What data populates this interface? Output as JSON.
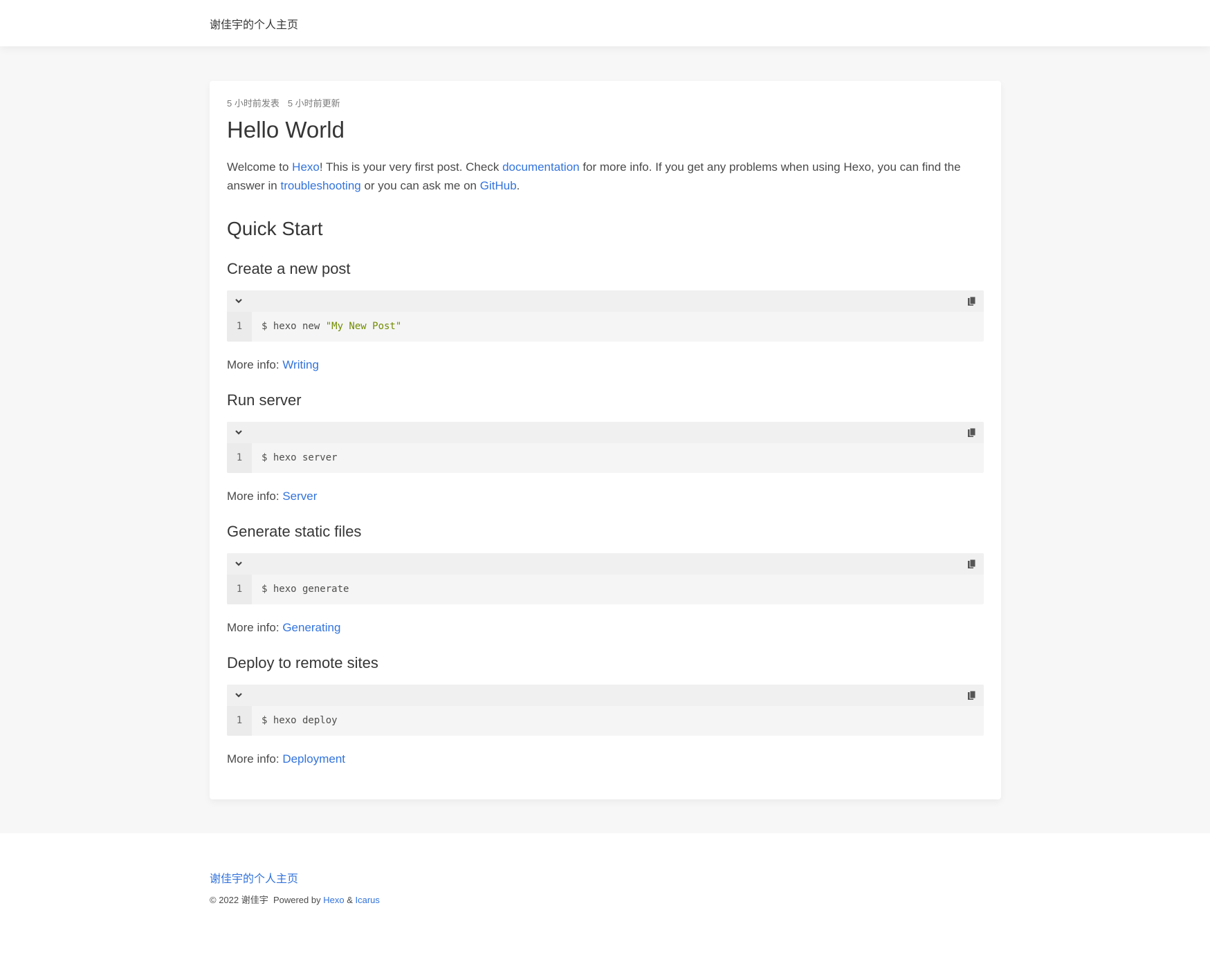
{
  "navbar": {
    "brand": "谢佳宇的个人主页"
  },
  "post": {
    "published": "5 小时前发表",
    "updated": "5 小时前更新",
    "title": "Hello World",
    "intro": {
      "t1": "Welcome to ",
      "link_hexo": "Hexo",
      "t2": "! This is your very first post. Check ",
      "link_docs": "documentation",
      "t3": " for more info. If you get any problems when using Hexo, you can find the answer in ",
      "link_trouble": "troubleshooting",
      "t4": " or you can ask me on ",
      "link_github": "GitHub",
      "t5": "."
    },
    "quick_start": "Quick Start",
    "more_info_label": "More info: ",
    "sections": [
      {
        "heading": "Create a new post",
        "line_no": "1",
        "code_prefix": "$ hexo new ",
        "code_string": "\"My New Post\"",
        "link": "Writing"
      },
      {
        "heading": "Run server",
        "line_no": "1",
        "code_prefix": "$ hexo server",
        "code_string": "",
        "link": "Server"
      },
      {
        "heading": "Generate static files",
        "line_no": "1",
        "code_prefix": "$ hexo generate",
        "code_string": "",
        "link": "Generating"
      },
      {
        "heading": "Deploy to remote sites",
        "line_no": "1",
        "code_prefix": "$ hexo deploy",
        "code_string": "",
        "link": "Deployment"
      }
    ]
  },
  "icons": {
    "fold": "chevron-down-icon",
    "copy": "copy-icon"
  },
  "footer": {
    "title": "谢佳宇的个人主页",
    "copyright": "© 2022 谢佳宇  Powered by ",
    "link_hexo": "Hexo",
    "amp": " & ",
    "link_icarus": "Icarus"
  },
  "colors": {
    "link": "#3273dc",
    "string": "#718c00",
    "background": "#f7f7f7"
  }
}
